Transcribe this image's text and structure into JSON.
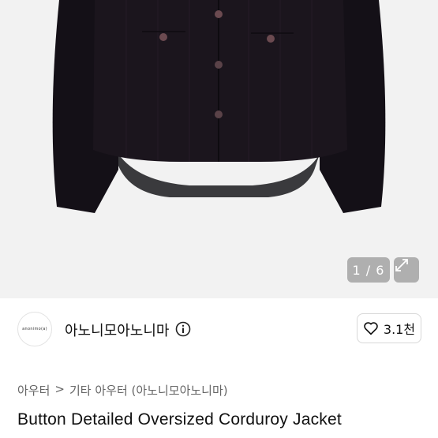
{
  "gallery": {
    "counter": "1 / 6",
    "expand_icon": "expand-icon"
  },
  "seller": {
    "avatar_text": "anonimo(a)",
    "name": "아노니모아노니마",
    "info_icon": "info-icon"
  },
  "like": {
    "icon": "heart-icon",
    "count": "3.1천"
  },
  "breadcrumb": {
    "level1": "아우터",
    "separator": ">",
    "level2": "기타 아우터 (아노니모아노니마)"
  },
  "product": {
    "title": "Button Detailed Oversized Corduroy Jacket"
  }
}
